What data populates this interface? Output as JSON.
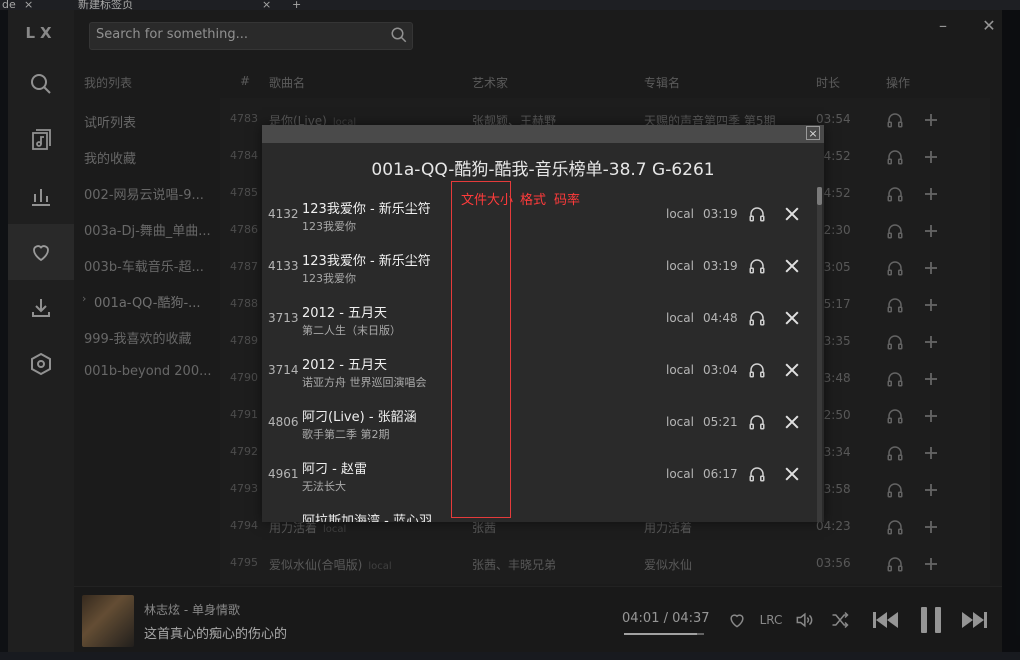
{
  "os": {
    "tab1": "de",
    "tab2": "新建标签页"
  },
  "app": {
    "logo": "LX",
    "search_placeholder": "Search for something...",
    "lists_title": "我的列表",
    "lists": [
      "试听列表",
      "我的收藏",
      "002-网易云说唱-9...",
      "003a-Dj-舞曲_单曲...",
      "003b-车载音乐-超...",
      "001a-QQ-酷狗-...",
      "999-我喜欢的收藏",
      "001b-beyond 200..."
    ],
    "table_headers": {
      "num": "#",
      "name": "歌曲名",
      "artist": "艺术家",
      "album": "专辑名",
      "duration": "时长",
      "ops": "操作"
    },
    "bg_rows": [
      {
        "num": "4783",
        "name": "是你(Live)",
        "local": "local",
        "artist": "张靓颖、王赫野",
        "album": "天赐的声音第四季 第5期",
        "dur": "03:54"
      },
      {
        "num": "4784",
        "name": "",
        "local": "",
        "artist": "",
        "album": "",
        "dur": "04:52"
      },
      {
        "num": "4785",
        "name": "",
        "local": "",
        "artist": "",
        "album": "",
        "dur": "04:52"
      },
      {
        "num": "4786",
        "name": "",
        "local": "",
        "artist": "",
        "album": "",
        "dur": "02:30"
      },
      {
        "num": "4787",
        "name": "",
        "local": "",
        "artist": "",
        "album": "",
        "dur": "03:05"
      },
      {
        "num": "4788",
        "name": "",
        "local": "",
        "artist": "",
        "album": "",
        "dur": "05:17"
      },
      {
        "num": "4789",
        "name": "",
        "local": "",
        "artist": "",
        "album": "",
        "dur": "03:35"
      },
      {
        "num": "4790",
        "name": "",
        "local": "",
        "artist": "",
        "album": "",
        "dur": "03:48"
      },
      {
        "num": "4791",
        "name": "",
        "local": "",
        "artist": "",
        "album": "",
        "dur": "02:50"
      },
      {
        "num": "4792",
        "name": "",
        "local": "",
        "artist": "",
        "album": "",
        "dur": "03:34"
      },
      {
        "num": "4793",
        "name": "",
        "local": "",
        "artist": "",
        "album": "",
        "dur": "03:58"
      },
      {
        "num": "4794",
        "name": "用力活着",
        "local": "local",
        "artist": "张茜",
        "album": "用力活着",
        "dur": "04:23"
      },
      {
        "num": "4795",
        "name": "爱似水仙(合唱版)",
        "local": "local",
        "artist": "张茜、丰晓兄弟",
        "album": "爱似水仙",
        "dur": "03:56"
      }
    ],
    "player": {
      "song": "林志炫 - 单身情歌",
      "lyric": "这首真心的痴心的伤心的",
      "time": "04:01 / 04:37",
      "progress": 0.918,
      "lrc": "LRC"
    }
  },
  "modal": {
    "title": "001a-QQ-酷狗-酷我-音乐榜单-38.7 G-6261",
    "close": "×",
    "annotations": [
      "文件大小",
      "格式",
      "码率"
    ],
    "rows": [
      {
        "num": "4132",
        "title": "123我爱你 - 新乐尘符",
        "sub": "123我爱你",
        "src": "local",
        "dur": "03:19"
      },
      {
        "num": "4133",
        "title": "123我爱你 - 新乐尘符",
        "sub": "123我爱你",
        "src": "local",
        "dur": "03:19"
      },
      {
        "num": "3713",
        "title": "2012 - 五月天",
        "sub": "第二人生（末日版）",
        "src": "local",
        "dur": "04:48"
      },
      {
        "num": "3714",
        "title": "2012 - 五月天",
        "sub": "诺亚方舟 世界巡回演唱会",
        "src": "local",
        "dur": "03:04"
      },
      {
        "num": "4806",
        "title": "阿刁(Live) - 张韶涵",
        "sub": "歌手第二季 第2期",
        "src": "local",
        "dur": "05:21"
      },
      {
        "num": "4961",
        "title": "阿刁 - 赵雷",
        "sub": "无法长大",
        "src": "local",
        "dur": "06:17"
      },
      {
        "num": "",
        "title": "阿拉斯加海湾 - 蓝心羽",
        "sub": "",
        "src": "",
        "dur": ""
      }
    ]
  }
}
